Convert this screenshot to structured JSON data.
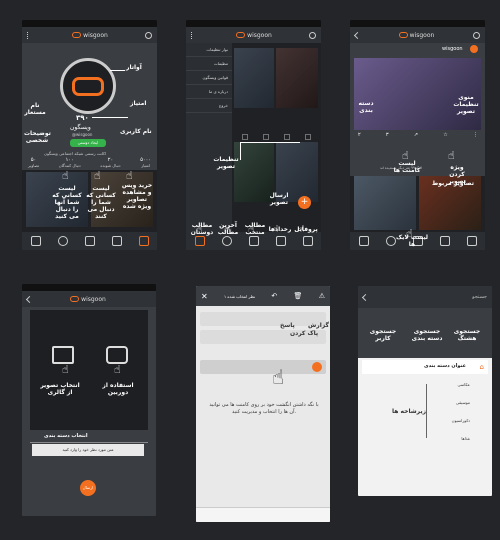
{
  "app_logo": "wisgoon",
  "colors": {
    "accent": "#f37021",
    "bg": "#232529",
    "panel": "#3a3d42"
  },
  "screen1": {
    "avatar_label": "آواتار",
    "name_label": "نام مستعار",
    "score_value": "۳۹۰",
    "score_label": "امتیاز",
    "username_label": "نام کاربری",
    "display_name": "ویسگون",
    "handle": "@wisgoon",
    "follow_button": "ایجاد دوستی",
    "bio_text": "اکانت رسمی شبکه اجتماعی ویسگون",
    "bio_label": "توضیحات شخصی",
    "stats": [
      {
        "value": "۵۰",
        "label": "تصاویر"
      },
      {
        "value": "۱۰۰",
        "label": "دنبال کنندگان"
      },
      {
        "value": "۲۰",
        "label": "دنبال شونده"
      },
      {
        "value": "۵۰۰۰",
        "label": "امتیاز"
      }
    ],
    "callouts": [
      "لیست کسانی که شما آنها را دنبال می کنید",
      "لیست کسانی که شما را دنبال می کنند",
      "خرید ویس و مشاهده تصاویر ویژه شده"
    ]
  },
  "screen2": {
    "drawer_items": [
      "نوار تنظیمات",
      "تنظیمات",
      "قوانین ویسگون",
      "درباره ی ما",
      "خروج"
    ],
    "callouts": {
      "image_settings": "تنظیمات تصویر",
      "send_image": "ارسال تصویر"
    },
    "bottom_labels": [
      "مطالب دوستان",
      "آخرین مطالب",
      "مطالب منتخب",
      "رخدادها",
      "پروفایل"
    ]
  },
  "screen3": {
    "user": "wisgoon",
    "callouts": {
      "category": "دسته بندی",
      "settings_menu": "منوی تنظیمات تصویر",
      "feature": "ویژه کردن تصویر",
      "comments": "لیست کامنت ها",
      "likes": "لیست لایک ها",
      "related": "تصاویر مربوط"
    },
    "like_count": "۲",
    "comment_count": "۳",
    "liked_by": "لایک ۹۹ نفر دیگر پسندیده اند"
  },
  "screen4": {
    "gallery_label": "انتخاب تصویر از گالری",
    "camera_label": "استفاده از دوربین",
    "category_field": "انتخاب دسته بندی",
    "text_placeholder": "متن مورد نظر خود را وارد کنید",
    "send_button": "ارسال"
  },
  "screen5": {
    "header": "۱ نظر انتخاب شده",
    "callouts": {
      "reply": "پاسخ",
      "delete": "پاک کردن",
      "report": "گزارش"
    },
    "instruction": "با نگه داشتن انگشت خود بر روی کامنت ها می توانید آن ها را انتخاب و مدیریت کنید."
  },
  "screen6": {
    "search_placeholder": "جستجو",
    "tabs": [
      "جستجوی هشتگ",
      "جستجوی دسته بندی",
      "جستجوی کاربر"
    ],
    "category_title": "عنوان دسته بندی",
    "subcategories_label": "زیرشاخه ها",
    "sub_items": [
      "عکاسی",
      "موسیقی",
      "دکوراسیون",
      "غذاها"
    ]
  }
}
